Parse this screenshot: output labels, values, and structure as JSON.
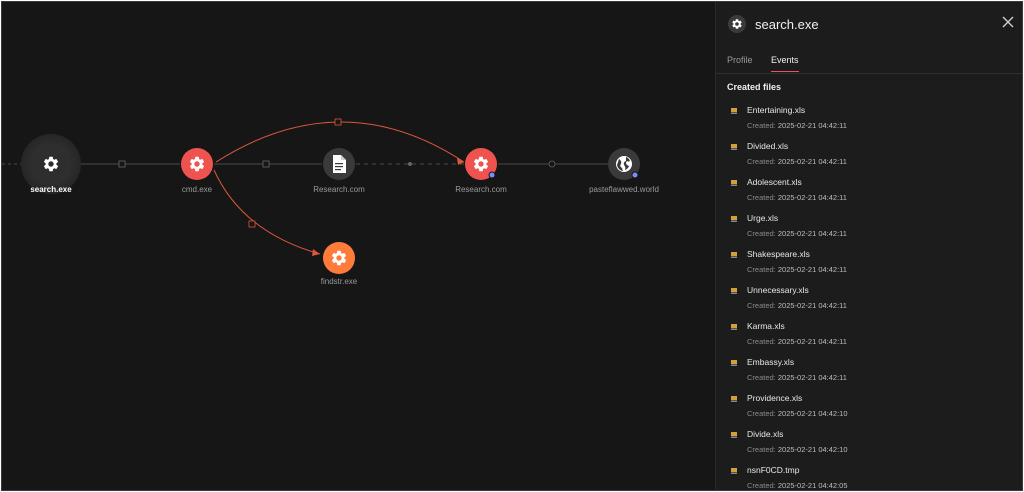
{
  "graph": {
    "nodes": {
      "search_exe": {
        "label": "search.exe"
      },
      "cmd_exe": {
        "label": "cmd.exe"
      },
      "research_file": {
        "label": "Research.com"
      },
      "research_proc": {
        "label": "Research.com"
      },
      "pasteflawwed": {
        "label": "pasteflawwed.world"
      },
      "findstr_exe": {
        "label": "findstr.exe"
      }
    },
    "colors": {
      "malicious": "#ef5350",
      "suspicious": "#ff7b3a",
      "neutral": "#3a3a3a",
      "edge": "#4a4a4a",
      "edge_hot": "#d9573c",
      "dot": "#7b8cff"
    }
  },
  "panel": {
    "title": "search.exe",
    "icon": "gear-icon",
    "close_icon": "close-icon",
    "tabs": [
      {
        "label": "Profile",
        "active": false
      },
      {
        "label": "Events",
        "active": true
      }
    ],
    "section_title": "Created files",
    "created_prefix": "Created:",
    "files": [
      {
        "name": "Entertaining.xls",
        "created": "2025-02-21 04:42:11"
      },
      {
        "name": "Divided.xls",
        "created": "2025-02-21 04:42:11"
      },
      {
        "name": "Adolescent.xls",
        "created": "2025-02-21 04:42:11"
      },
      {
        "name": "Urge.xls",
        "created": "2025-02-21 04:42:11"
      },
      {
        "name": "Shakespeare.xls",
        "created": "2025-02-21 04:42:11"
      },
      {
        "name": "Unnecessary.xls",
        "created": "2025-02-21 04:42:11"
      },
      {
        "name": "Karma.xls",
        "created": "2025-02-21 04:42:11"
      },
      {
        "name": "Embassy.xls",
        "created": "2025-02-21 04:42:11"
      },
      {
        "name": "Providence.xls",
        "created": "2025-02-21 04:42:10"
      },
      {
        "name": "Divide.xls",
        "created": "2025-02-21 04:42:10"
      },
      {
        "name": "nsnF0CD.tmp",
        "created": "2025-02-21 04:42:05"
      }
    ]
  }
}
